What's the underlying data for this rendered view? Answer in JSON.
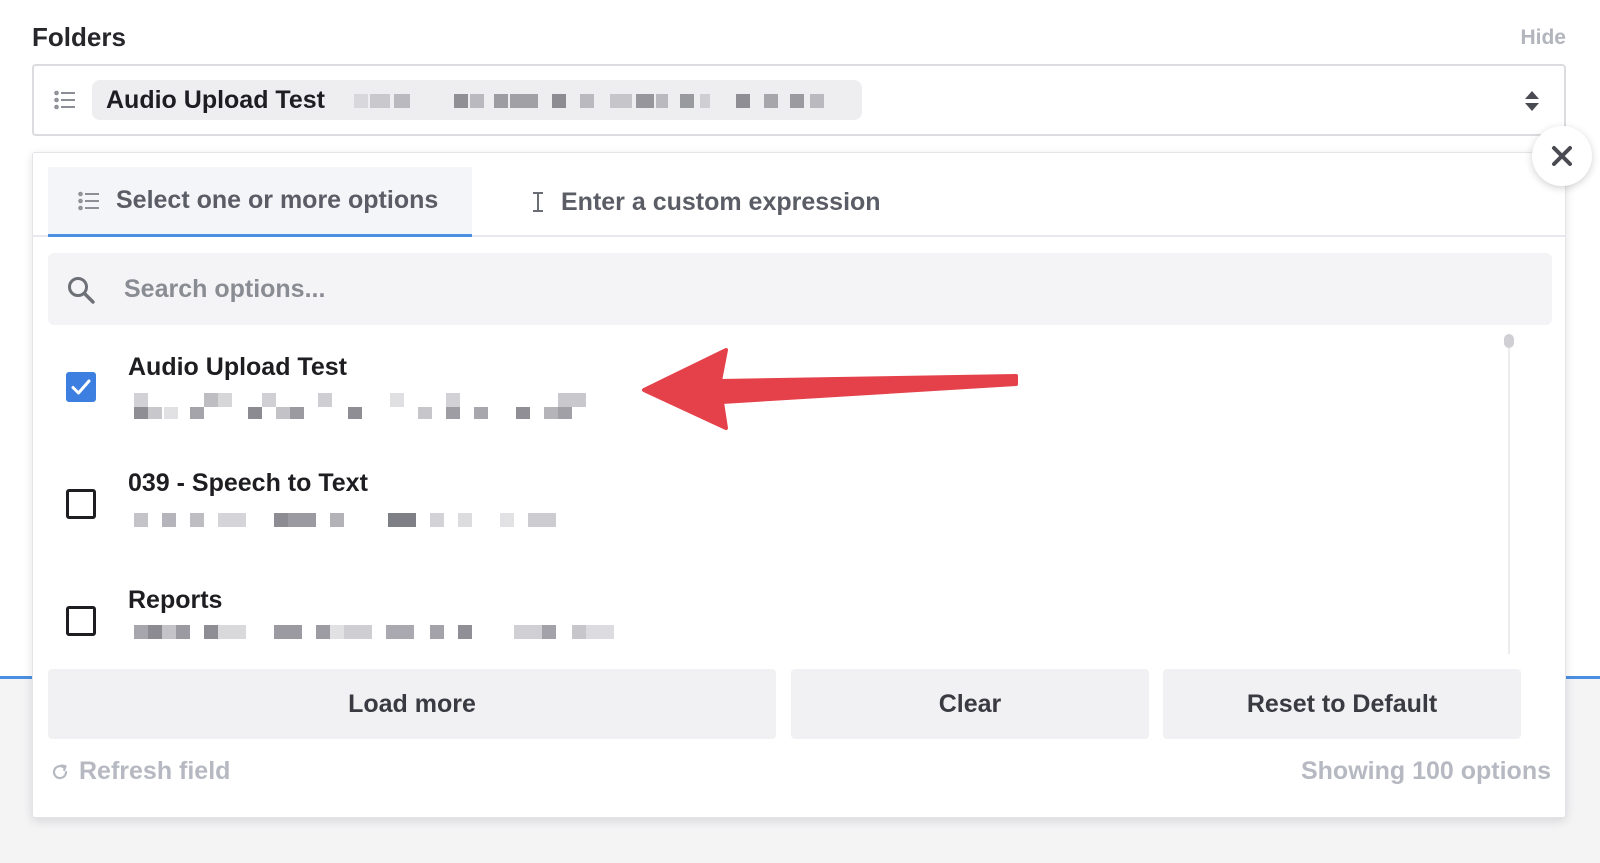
{
  "field": {
    "label": "Folders",
    "hide_label": "Hide",
    "selected_chip": "Audio Upload Test"
  },
  "tabs": [
    {
      "label": "Select one or more options",
      "active": true
    },
    {
      "label": "Enter a custom expression",
      "active": false
    }
  ],
  "search": {
    "placeholder": "Search options..."
  },
  "options": [
    {
      "title": "Audio Upload Test",
      "checked": true
    },
    {
      "title": "039 - Speech to Text",
      "checked": false
    },
    {
      "title": "Reports",
      "checked": false
    }
  ],
  "buttons": {
    "load_more": "Load more",
    "clear": "Clear",
    "reset": "Reset to Default"
  },
  "footer": {
    "refresh_label": "Refresh field",
    "showing_label": "Showing 100 options"
  },
  "colors": {
    "accent": "#3d7fe0",
    "annotation_arrow": "#e5414a"
  },
  "icons": {
    "list": "list-icon",
    "updown": "chevron-updown-icon",
    "close": "close-icon",
    "cursor": "text-cursor-icon",
    "search": "search-icon",
    "check": "checkmark-icon",
    "refresh": "refresh-icon"
  }
}
